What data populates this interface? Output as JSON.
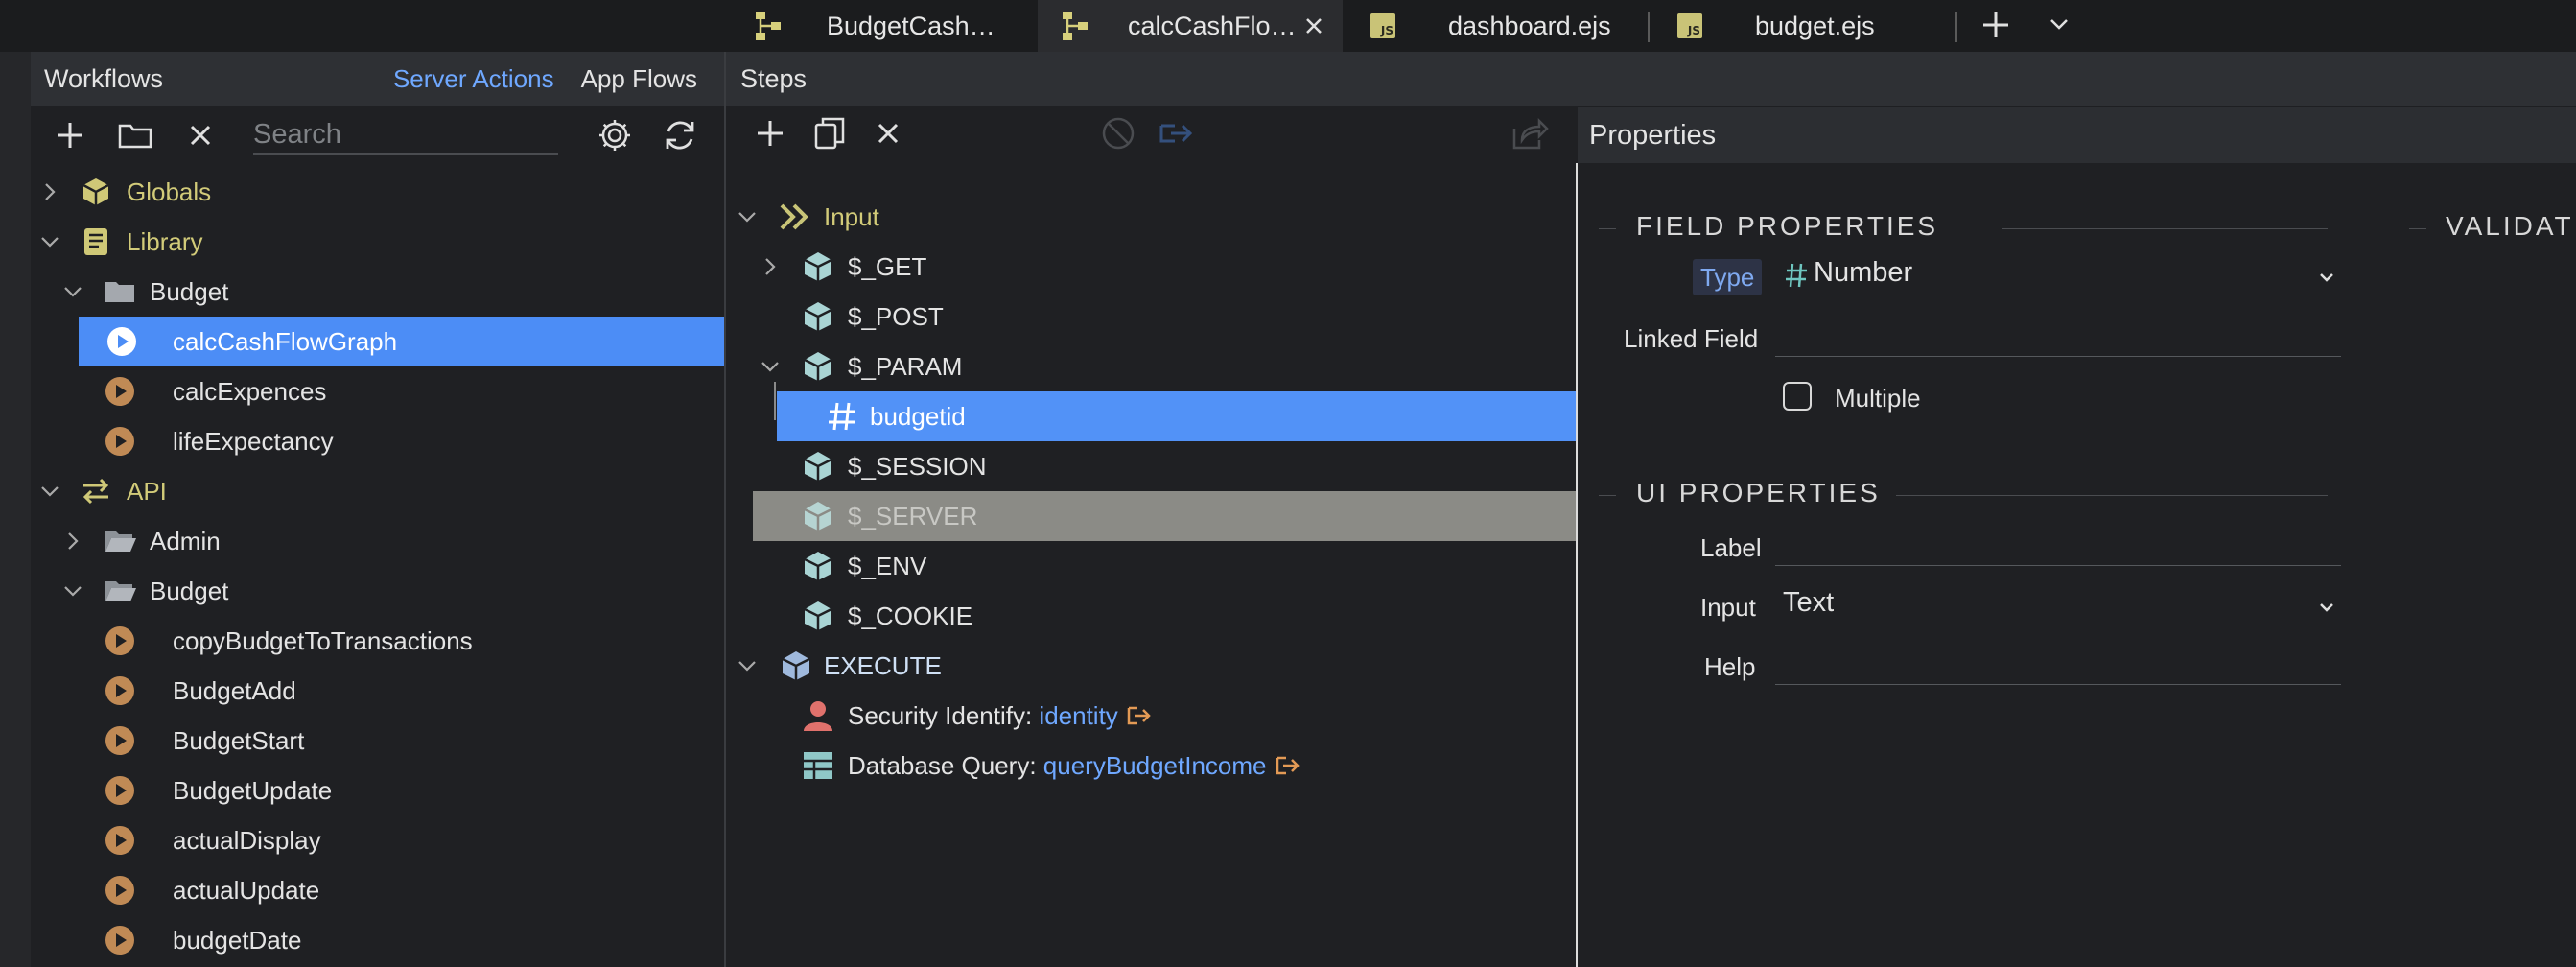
{
  "tabs": [
    {
      "label": "BudgetCash…",
      "icon": "flow-icon",
      "active": false,
      "closable": false
    },
    {
      "label": "calcCashFlo…",
      "icon": "flow-icon",
      "active": true,
      "closable": true
    },
    {
      "label": "dashboard.ejs",
      "icon": "js-file-icon",
      "active": false,
      "closable": false
    },
    {
      "label": "budget.ejs",
      "icon": "js-file-icon",
      "active": false,
      "closable": false
    }
  ],
  "js_badge": "JS",
  "left": {
    "title": "Workflows",
    "link_server_actions": "Server Actions",
    "link_app_flows": "App Flows",
    "search_placeholder": "Search",
    "tree": [
      {
        "label": "Globals",
        "icon": "cube-icon",
        "expanded": false,
        "level": 0,
        "color": "yellow"
      },
      {
        "label": "Library",
        "icon": "book-icon",
        "expanded": true,
        "level": 0,
        "color": "yellow"
      },
      {
        "label": "Budget",
        "icon": "folder-icon",
        "expanded": true,
        "level": 1
      },
      {
        "label": "calcCashFlowGraph",
        "icon": "play-icon",
        "level": 2,
        "selected": true
      },
      {
        "label": "calcExpences",
        "icon": "play-icon",
        "level": 2
      },
      {
        "label": "lifeExpectancy",
        "icon": "play-icon",
        "level": 2
      },
      {
        "label": "API",
        "icon": "api-icon",
        "expanded": true,
        "level": 0,
        "color": "yellow"
      },
      {
        "label": "Admin",
        "icon": "open-folder-icon",
        "expanded": false,
        "level": 1
      },
      {
        "label": "Budget",
        "icon": "open-folder-icon",
        "expanded": true,
        "level": 1
      },
      {
        "label": "copyBudgetToTransactions",
        "icon": "play-icon",
        "level": 2
      },
      {
        "label": "BudgetAdd",
        "icon": "play-icon",
        "level": 2
      },
      {
        "label": "BudgetStart",
        "icon": "play-icon",
        "level": 2
      },
      {
        "label": "BudgetUpdate",
        "icon": "play-icon",
        "level": 2
      },
      {
        "label": "actualDisplay",
        "icon": "play-icon",
        "level": 2
      },
      {
        "label": "actualUpdate",
        "icon": "play-icon",
        "level": 2
      },
      {
        "label": "budgetDate",
        "icon": "play-icon",
        "level": 2
      }
    ]
  },
  "steps": {
    "title": "Steps",
    "rows": [
      {
        "label": "Input",
        "icon": "input-icon",
        "expanded": true
      },
      {
        "label": "$_GET",
        "icon": "cube-icon",
        "expanded": false
      },
      {
        "label": "$_POST",
        "icon": "cube-icon"
      },
      {
        "label": "$_PARAM",
        "icon": "cube-icon",
        "expanded": true
      },
      {
        "label": "budgetid",
        "icon": "hash-icon",
        "selected": true
      },
      {
        "label": "$_SESSION",
        "icon": "cube-icon"
      },
      {
        "label": "$_SERVER",
        "icon": "cube-icon",
        "dimmed": true
      },
      {
        "label": "$_ENV",
        "icon": "cube-icon"
      },
      {
        "label": "$_COOKIE",
        "icon": "cube-icon"
      },
      {
        "label": "EXECUTE",
        "icon": "execute-cube-icon",
        "expanded": true
      },
      {
        "label": "Security Identify: ",
        "ref": "identity",
        "icon": "user-icon"
      },
      {
        "label": "Database Query: ",
        "ref": "queryBudgetIncome",
        "icon": "table-icon"
      }
    ]
  },
  "properties": {
    "title": "Properties",
    "field_section": "FIELD PROPERTIES",
    "validate_section": "VALIDAT",
    "type_label": "Type",
    "type_value": "Number",
    "linked_label": "Linked Field",
    "linked_value": "",
    "multiple_label": "Multiple",
    "ui_section": "UI PROPERTIES",
    "label_label": "Label",
    "label_value": "",
    "input_label": "Input",
    "input_value": "Text",
    "help_label": "Help",
    "help_value": ""
  }
}
